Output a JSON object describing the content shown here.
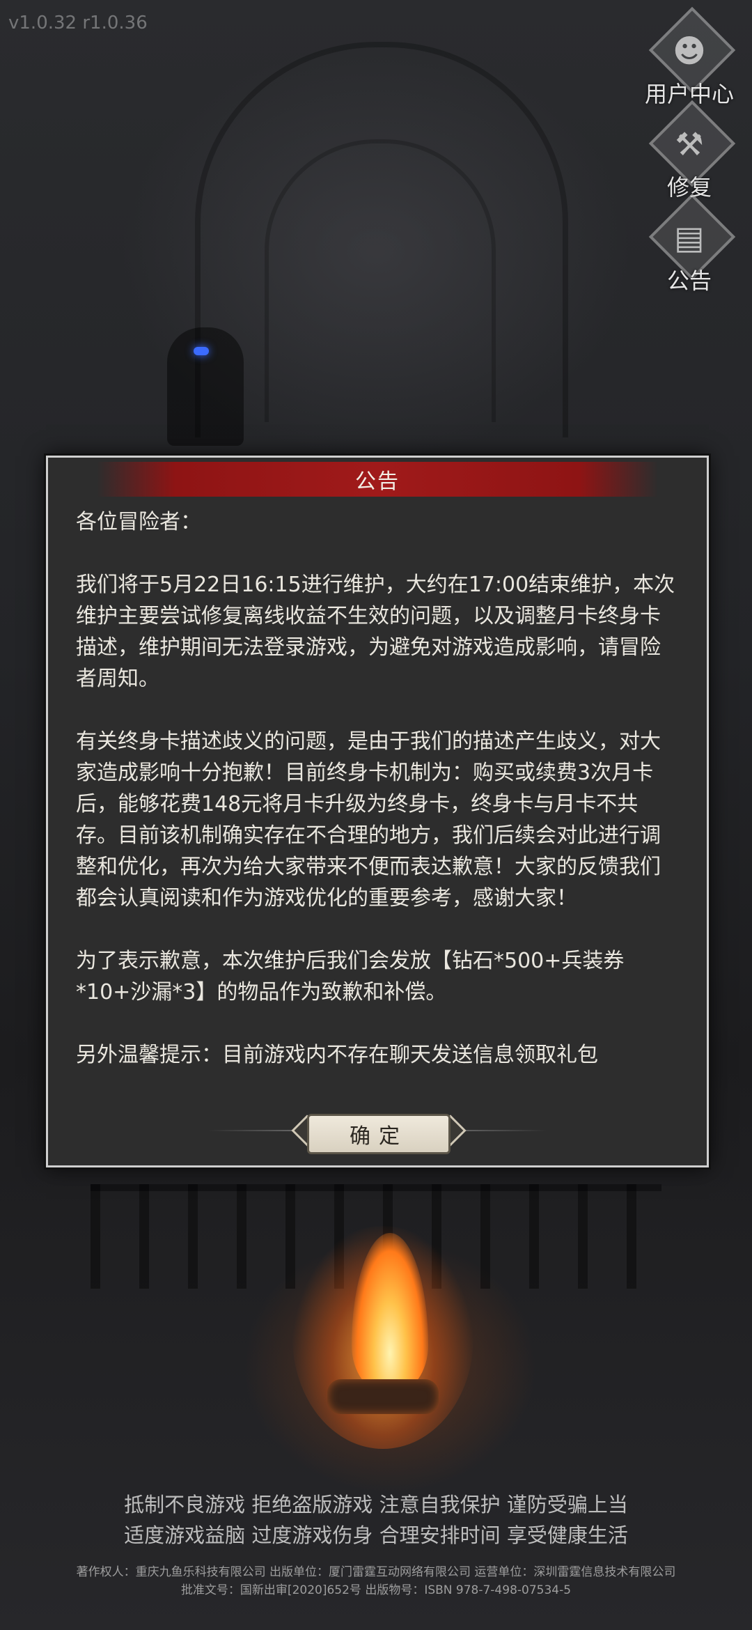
{
  "version": "v1.0.32 r1.0.36",
  "side_buttons": [
    {
      "label": "用户中心",
      "icon": "user-avatar-icon",
      "glyph": "☻"
    },
    {
      "label": "修复",
      "icon": "wrench-hammer-icon",
      "glyph": "⚒"
    },
    {
      "label": "公告",
      "icon": "notice-board-icon",
      "glyph": "▤"
    }
  ],
  "modal": {
    "title": "公告",
    "paragraphs": [
      "各位冒险者：",
      "我们将于5月22日16:15进行维护，大约在17:00结束维护，本次维护主要尝试修复离线收益不生效的问题，以及调整月卡终身卡描述，维护期间无法登录游戏，为避免对游戏造成影响，请冒险者周知。",
      "有关终身卡描述歧义的问题，是由于我们的描述产生歧义，对大家造成影响十分抱歉！目前终身卡机制为：购买或续费3次月卡后，能够花费148元将月卡升级为终身卡，终身卡与月卡不共存。目前该机制确实存在不合理的地方，我们后续会对此进行调整和优化，再次为给大家带来不便而表达歉意！大家的反馈我们都会认真阅读和作为游戏优化的重要参考，感谢大家！",
      "为了表示歉意，本次维护后我们会发放【钻石*500+兵装券*10+沙漏*3】的物品作为致歉和补偿。",
      "另外温馨提示：目前游戏内不存在聊天发送信息领取礼包"
    ],
    "confirm_label": "确定"
  },
  "health_notice": [
    "抵制不良游戏 拒绝盗版游戏 注意自我保护 谨防受骗上当",
    "适度游戏益脑 过度游戏伤身 合理安排时间 享受健康生活"
  ],
  "copyright": [
    "著作权人：重庆九鱼乐科技有限公司 出版单位：厦门雷霆互动网络有限公司 运营单位：深圳雷霆信息技术有限公司",
    "批准文号：国新出审[2020]652号 出版物号：ISBN 978-7-498-07534-5"
  ],
  "colors": {
    "title_bar": "#a01a1a",
    "modal_bg": "#2d2d2d",
    "confirm_bg": "#efe9dc",
    "text": "#eae7df"
  }
}
